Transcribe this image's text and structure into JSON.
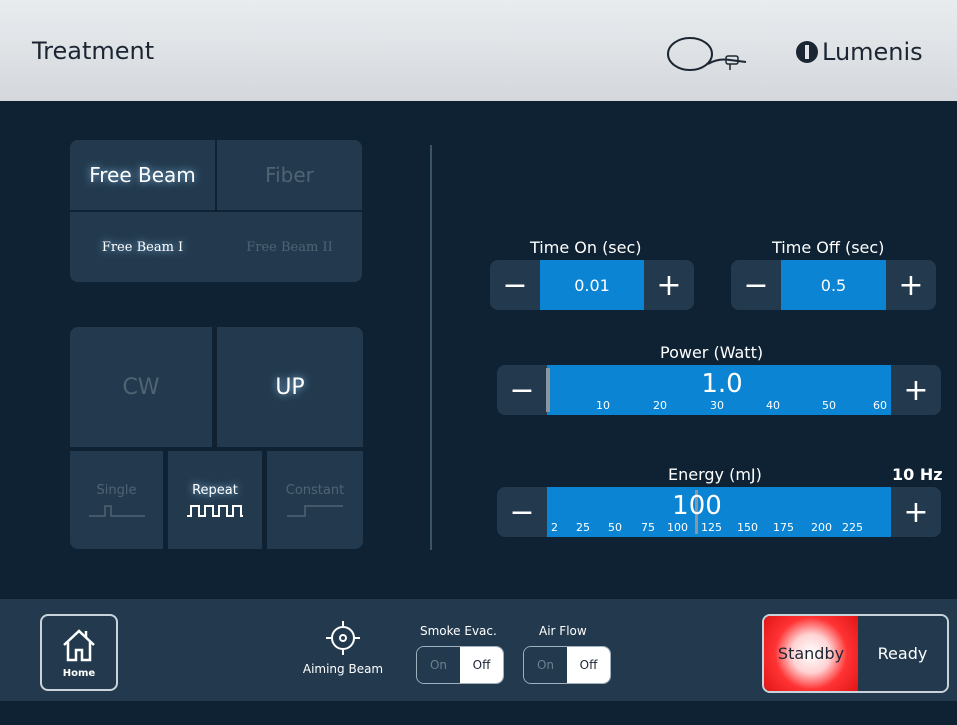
{
  "header": {
    "title": "Treatment",
    "handpiece_icon": "handpiece-icon",
    "logo_text": "Lumenis"
  },
  "delivery": {
    "options": [
      "Free Beam",
      "Fiber"
    ],
    "selected": "Free Beam",
    "sub_options": [
      "Free Beam I",
      "Free Beam II"
    ],
    "sub_selected": "Free Beam I"
  },
  "emission": {
    "modes": [
      "CW",
      "UP"
    ],
    "mode_selected": "UP",
    "pulse_modes": [
      "Single",
      "Repeat",
      "Constant"
    ],
    "pulse_selected": "Repeat"
  },
  "time_on": {
    "label": "Time On (sec)",
    "value": "0.01",
    "minus": "−",
    "plus": "+"
  },
  "time_off": {
    "label": "Time Off (sec)",
    "value": "0.5",
    "minus": "−",
    "plus": "+"
  },
  "power": {
    "label": "Power (Watt)",
    "value": "1.0",
    "ticks": [
      "10",
      "20",
      "30",
      "40",
      "50",
      "60"
    ],
    "minus": "−",
    "plus": "+"
  },
  "energy": {
    "label": "Energy (mJ)",
    "rate": "10 Hz",
    "value": "100",
    "ticks": [
      "2",
      "25",
      "50",
      "75",
      "100",
      "125",
      "150",
      "175",
      "200",
      "225"
    ],
    "minus": "−",
    "plus": "+"
  },
  "footer": {
    "home_label": "Home",
    "aiming_label": "Aiming Beam",
    "smoke": {
      "label": "Smoke Evac.",
      "on": "On",
      "off": "Off",
      "state": "Off"
    },
    "airflow": {
      "label": "Air Flow",
      "on": "On",
      "off": "Off",
      "state": "Off"
    },
    "standby_label": "Standby",
    "ready_label": "Ready",
    "state": "Standby"
  },
  "colors": {
    "background": "#0e2233",
    "panel": "#233a4e",
    "accent": "#0b84d4",
    "standby": "#e01515"
  }
}
